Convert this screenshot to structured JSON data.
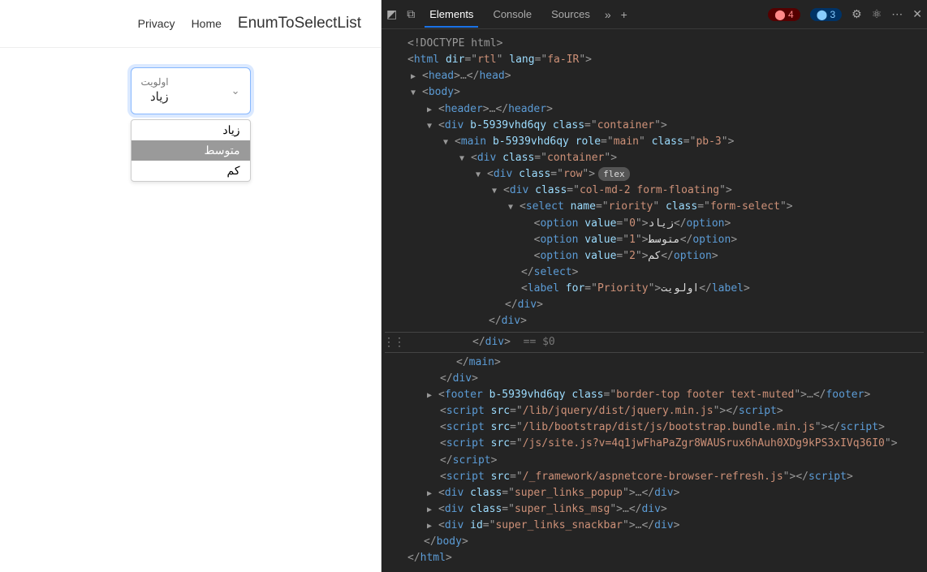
{
  "page": {
    "nav": {
      "privacy": "Privacy",
      "home": "Home",
      "brand": "EnumToSelectList"
    },
    "select": {
      "label": "اولویت",
      "value": "زیاد",
      "options": [
        "زیاد",
        "متوسط",
        "کم"
      ],
      "highlighted_index": 1
    }
  },
  "devtools": {
    "tabs": {
      "elements": "Elements",
      "console": "Console",
      "sources": "Sources"
    },
    "badges": {
      "errors": "4",
      "warnings": "3"
    },
    "chevrons": "»",
    "plus": "+",
    "dom": {
      "doctype": "<!DOCTYPE html>",
      "html_open": {
        "tag": "html",
        "attrs": [
          [
            "dir",
            "rtl"
          ],
          [
            "lang",
            "fa-IR"
          ]
        ]
      },
      "head": {
        "tag": "head"
      },
      "body_open": {
        "tag": "body"
      },
      "header": {
        "tag": "header"
      },
      "div_container": {
        "tag": "div",
        "attrs": [
          [
            "b-5939vhd6qy",
            null
          ],
          [
            "class",
            "container"
          ]
        ]
      },
      "main": {
        "tag": "main",
        "attrs": [
          [
            "b-5939vhd6qy",
            null
          ],
          [
            "role",
            "main"
          ],
          [
            "class",
            "pb-3"
          ]
        ]
      },
      "div_container2": {
        "tag": "div",
        "attrs": [
          [
            "class",
            "container"
          ]
        ]
      },
      "div_row": {
        "tag": "div",
        "attrs": [
          [
            "class",
            "row"
          ]
        ],
        "pill": "flex"
      },
      "div_col": {
        "tag": "div",
        "attrs": [
          [
            "class",
            "col-md-2 form-floating"
          ]
        ]
      },
      "select": {
        "tag": "select",
        "attrs": [
          [
            "name",
            "riority"
          ],
          [
            "class",
            "form-select"
          ]
        ]
      },
      "opt0": {
        "tag": "option",
        "attrs": [
          [
            "value",
            "0"
          ]
        ],
        "text": "زیاد"
      },
      "opt1": {
        "tag": "option",
        "attrs": [
          [
            "value",
            "1"
          ]
        ],
        "text": "متوسط"
      },
      "opt2": {
        "tag": "option",
        "attrs": [
          [
            "value",
            "2"
          ]
        ],
        "text": "کم"
      },
      "select_close": "select",
      "label": {
        "tag": "label",
        "attrs": [
          [
            "for",
            "Priority"
          ]
        ],
        "text": "اولویت"
      },
      "eq0": "== $0",
      "footer": {
        "tag": "footer",
        "attrs": [
          [
            "b-5939vhd6qy",
            null
          ],
          [
            "class",
            "border-top footer text-muted"
          ]
        ]
      },
      "scripts": [
        "/lib/jquery/dist/jquery.min.js",
        "/lib/bootstrap/dist/js/bootstrap.bundle.min.js",
        "/js/site.js?v=4q1jwFhaPaZgr8WAUSrux6hAuh0XDg9kPS3xIVq36I0",
        "/_framework/aspnetcore-browser-refresh.js"
      ],
      "divs_extra": [
        {
          "attrs": [
            [
              "class",
              "super_links_popup"
            ]
          ]
        },
        {
          "attrs": [
            [
              "class",
              "super_links_msg"
            ]
          ]
        },
        {
          "attrs": [
            [
              "id",
              "super_links_snackbar"
            ]
          ]
        }
      ]
    }
  }
}
